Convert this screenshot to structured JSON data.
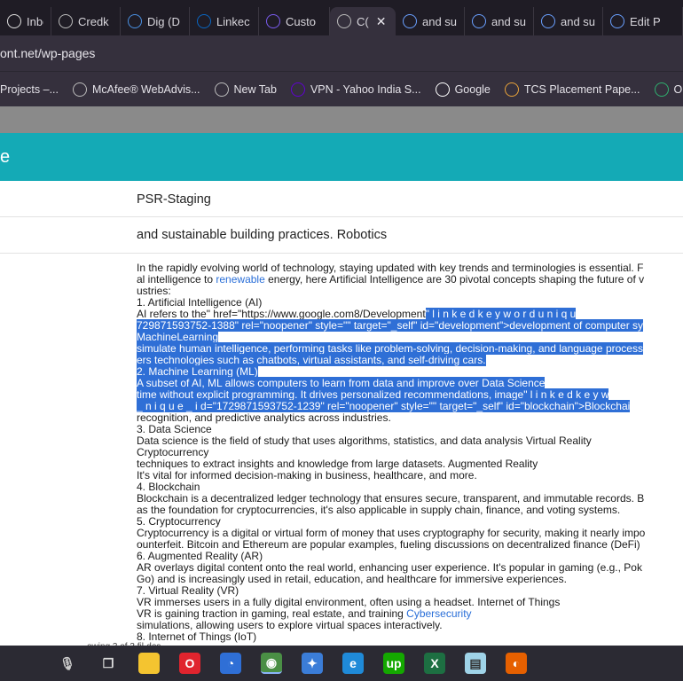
{
  "tabs": [
    {
      "label": "Inbox",
      "icon": "mail-icon",
      "color": "#e0e0e0"
    },
    {
      "label": "Credk",
      "icon": "globe-icon",
      "color": "#bbbbbb"
    },
    {
      "label": "Dig (D",
      "icon": "t-icon",
      "color": "#4a90e2"
    },
    {
      "label": "Linkec",
      "icon": "linkedin-icon",
      "color": "#0a66c2"
    },
    {
      "label": "Custo",
      "icon": "s-icon",
      "color": "#7b5cf0"
    },
    {
      "label": "C(",
      "icon": "globe-icon",
      "color": "#bbbbbb",
      "active": true
    },
    {
      "label": "and su",
      "icon": "chart-icon",
      "color": "#6aa0ff"
    },
    {
      "label": "and su",
      "icon": "chart-icon",
      "color": "#6aa0ff"
    },
    {
      "label": "and su",
      "icon": "chart-icon",
      "color": "#6aa0ff"
    },
    {
      "label": "Edit P",
      "icon": "chart-icon",
      "color": "#6aa0ff"
    }
  ],
  "address": {
    "url": "ont.net/wp-pages"
  },
  "bookmarks": [
    {
      "label": "Projects –...",
      "icon": "",
      "color": ""
    },
    {
      "label": "McAfee® WebAdvis...",
      "icon": "globe-icon",
      "color": "#bbbbbb"
    },
    {
      "label": "New Tab",
      "icon": "globe-icon",
      "color": "#bbbbbb"
    },
    {
      "label": "VPN - Yahoo India S...",
      "icon": "yahoo-icon",
      "color": "#6001d2"
    },
    {
      "label": "Google",
      "icon": "google-icon",
      "color": "#ffffff"
    },
    {
      "label": "TCS Placement Pape...",
      "icon": "tcs-icon",
      "color": "#e8a33a"
    },
    {
      "label": "Online Ca",
      "icon": "leaf-icon",
      "color": "#2fb06f"
    }
  ],
  "header": {
    "title": "e"
  },
  "rows": {
    "title_value": "PSR-Staging",
    "tag_value": "and sustainable building practices. Robotics"
  },
  "content_lines": [
    {
      "parts": [
        {
          "t": "In the rapidly evolving world of technology, staying updated with key trends and terminologies is essential. F"
        }
      ]
    },
    {
      "parts": [
        {
          "t": "al intelligence to "
        },
        {
          "t": "renewable",
          "c": "link"
        },
        {
          "t": " energy, here Artificial Intelligence are 30 pivotal concepts shaping the future of v"
        }
      ]
    },
    {
      "parts": [
        {
          "t": "ustries:"
        }
      ]
    },
    {
      "parts": [
        {
          "t": "1. Artificial Intelligence (AI)"
        }
      ]
    },
    {
      "parts": [
        {
          "t": "AI refers to the\" href=\"https://www.google.com8/Development"
        },
        {
          "t": "\" l i n k e d   k e y w o r d   u n i q u",
          "c": "hl"
        }
      ]
    },
    {
      "parts": [
        {
          "t": "729871593752-1388\" rel=\"noopener\" style=\"\" target=\"_self\" id=\"development\">development of computer sy",
          "c": "hl"
        }
      ]
    },
    {
      "parts": [
        {
          "t": "MachineLearning ",
          "c": "hl"
        }
      ]
    },
    {
      "parts": [
        {
          "t": "simulate human intelligence, performing tasks like problem-solving, decision-making, and language process",
          "c": "hl"
        }
      ]
    },
    {
      "parts": [
        {
          "t": "ers technologies such as chatbots, virtual assistants, and self-driving cars.",
          "c": "hl"
        }
      ]
    },
    {
      "parts": [
        {
          "t": "2. Machine Learning (ML) ",
          "c": "hl"
        }
      ]
    },
    {
      "parts": [
        {
          "t": "A subset of AI, ML allows computers to learn from data and improve over Data Science ",
          "c": "hl"
        }
      ]
    },
    {
      "parts": [
        {
          "t": "time without explicit programming. It drives personalized recommendations, image\" l i n k e d   k e y w",
          "c": "hl"
        }
      ]
    },
    {
      "parts": [
        {
          "t": " _ n i q u e _ i d=\"1729871593752-1239\" rel=\"noopener\" style=\"\" target=\"_self\" id=\"blockchain\">Blockchai",
          "c": "hl"
        }
      ]
    },
    {
      "parts": [
        {
          "t": "recognition, and predictive analytics across industries."
        }
      ]
    },
    {
      "parts": [
        {
          "t": "3. Data Science"
        }
      ]
    },
    {
      "parts": [
        {
          "t": "Data science is the field of study that uses algorithms, statistics, and data analysis Virtual Reality"
        }
      ]
    },
    {
      "parts": [
        {
          "t": "Cryptocurrency"
        }
      ]
    },
    {
      "parts": [
        {
          "t": "techniques to extract insights and knowledge from large datasets. Augmented Reality"
        }
      ]
    },
    {
      "parts": [
        {
          "t": "It's vital for informed decision-making in business, healthcare, and more."
        }
      ]
    },
    {
      "parts": [
        {
          "t": "4. Blockchain"
        }
      ]
    },
    {
      "parts": [
        {
          "t": "Blockchain is a decentralized ledger technology that ensures secure, transparent, and immutable records. B"
        }
      ]
    },
    {
      "parts": [
        {
          "t": "as the foundation for cryptocurrencies, it's also applicable in supply chain, finance, and voting systems."
        }
      ]
    },
    {
      "parts": [
        {
          "t": "5. Cryptocurrency"
        }
      ]
    },
    {
      "parts": [
        {
          "t": "Cryptocurrency is a digital or virtual form of money that uses cryptography for security, making it nearly impo"
        }
      ]
    },
    {
      "parts": [
        {
          "t": "ounterfeit. Bitcoin and Ethereum are popular examples, fueling discussions on decentralized finance (DeFi)"
        }
      ]
    },
    {
      "parts": [
        {
          "t": "6. Augmented Reality (AR)"
        }
      ]
    },
    {
      "parts": [
        {
          "t": "AR overlays digital content onto the real world, enhancing user experience. It's popular in gaming (e.g., Pok"
        }
      ]
    },
    {
      "parts": [
        {
          "t": "Go) and is increasingly used in retail, education, and healthcare for immersive experiences."
        }
      ]
    },
    {
      "parts": [
        {
          "t": "7. Virtual Reality (VR)"
        }
      ]
    },
    {
      "parts": [
        {
          "t": "VR immerses users in a fully digital environment, often using a headset. Internet of Things"
        }
      ]
    },
    {
      "parts": [
        {
          "t": "VR is gaining traction in gaming, real estate, and training "
        },
        {
          "t": "Cybersecurity",
          "c": "link"
        }
      ]
    },
    {
      "parts": [
        {
          "t": "simulations, allowing users to explore virtual spaces interactively."
        }
      ]
    },
    {
      "parts": [
        {
          "t": "8. Internet of Things (IoT)"
        }
      ]
    }
  ],
  "footer": {
    "showing": "owing 3 of 3 fil-des"
  },
  "taskbar": [
    {
      "icon": "microphone-icon",
      "glyph": "🎙",
      "color": "#cccccc",
      "bg": "transparent"
    },
    {
      "icon": "task-view-icon",
      "glyph": "❐",
      "color": "#dddddd",
      "bg": "transparent"
    },
    {
      "icon": "file-explorer-icon",
      "glyph": "▬",
      "color": "#f4c430",
      "bg": "#f4c430"
    },
    {
      "icon": "opera-icon",
      "glyph": "O",
      "color": "#ffffff",
      "bg": "#e0242e"
    },
    {
      "icon": "clock-app-icon",
      "glyph": "◔",
      "color": "#ffffff",
      "bg": "#2f6fd6"
    },
    {
      "icon": "chrome-icon",
      "glyph": "◉",
      "color": "#ffffff",
      "bg": "#4a8f45"
    },
    {
      "icon": "network-app-icon",
      "glyph": "✦",
      "color": "#ffffff",
      "bg": "#3b7dd8"
    },
    {
      "icon": "edge-icon",
      "glyph": "e",
      "color": "#ffffff",
      "bg": "#1f8ad8"
    },
    {
      "icon": "upwork-icon",
      "glyph": "up",
      "color": "#ffffff",
      "bg": "#14a800"
    },
    {
      "icon": "excel-icon",
      "glyph": "X",
      "color": "#ffffff",
      "bg": "#1d6f42"
    },
    {
      "icon": "notepad-icon",
      "glyph": "▤",
      "color": "#333333",
      "bg": "#9fd3e8"
    },
    {
      "icon": "firefox-icon",
      "glyph": "◐",
      "color": "#ffffff",
      "bg": "#e66000"
    }
  ]
}
